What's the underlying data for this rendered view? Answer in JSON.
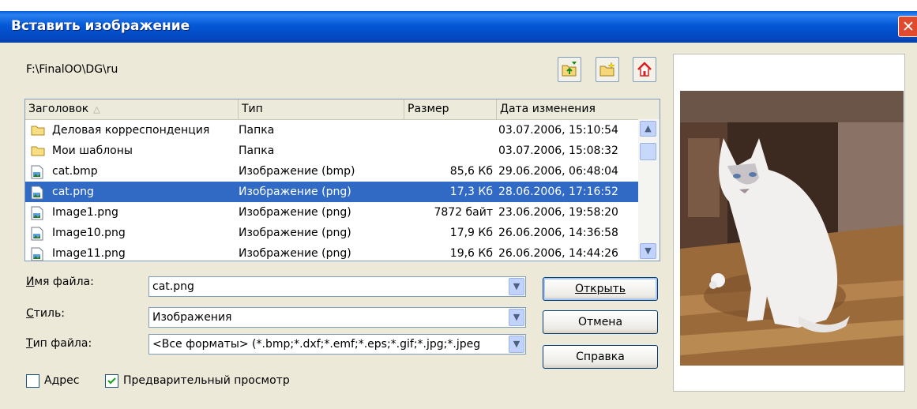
{
  "window": {
    "title": "Вставить изображение",
    "close_glyph": "✕"
  },
  "path": "F:\\FinalOO\\DG\\ru",
  "toolbar": {
    "icons": [
      "folder-up-icon",
      "new-folder-icon",
      "home-icon"
    ]
  },
  "columns": [
    "Заголовок",
    "Тип",
    "Размер",
    "Дата изменения"
  ],
  "files": [
    {
      "name": "Деловая корреспонденция",
      "type": "Папка",
      "size": "",
      "date": "03.07.2006, 15:10:54",
      "icon": "folder"
    },
    {
      "name": "Мои шаблоны",
      "type": "Папка",
      "size": "",
      "date": "03.07.2006, 15:08:32",
      "icon": "folder"
    },
    {
      "name": "cat.bmp",
      "type": "Изображение (bmp)",
      "size": "85,6 Кб",
      "date": "29.06.2006, 06:48:04",
      "icon": "image"
    },
    {
      "name": "cat.png",
      "type": "Изображение (png)",
      "size": "17,3 Кб",
      "date": "28.06.2006, 17:16:52",
      "icon": "image",
      "selected": true
    },
    {
      "name": "Image1.png",
      "type": "Изображение (png)",
      "size": "7872 байт",
      "date": "23.06.2006, 19:58:20",
      "icon": "image"
    },
    {
      "name": "Image10.png",
      "type": "Изображение (png)",
      "size": "17,9 Кб",
      "date": "26.06.2006, 14:36:58",
      "icon": "image"
    },
    {
      "name": "Image11.png",
      "type": "Изображение (png)",
      "size": "19,6 Кб",
      "date": "26.06.2006, 14:44:26",
      "icon": "image"
    }
  ],
  "form": {
    "filename": {
      "label": "Имя файла:",
      "value": "cat.png"
    },
    "style": {
      "label": "Стиль:",
      "value": "Изображения"
    },
    "filetype": {
      "label": "Тип файла:",
      "value": "<Все форматы> (*.bmp;*.dxf;*.emf;*.eps;*.gif;*.jpg;*.jpeg"
    }
  },
  "buttons": {
    "open": "Открыть",
    "cancel": "Отмена",
    "help": "Справка"
  },
  "options": {
    "address": {
      "label": "Адрес",
      "checked": false
    },
    "preview": {
      "label": "Предварительный просмотр",
      "checked": true
    }
  },
  "colors": {
    "titlebar": "#0458d6",
    "selection": "#316ac5",
    "dialog_bg": "#ece9d8"
  }
}
